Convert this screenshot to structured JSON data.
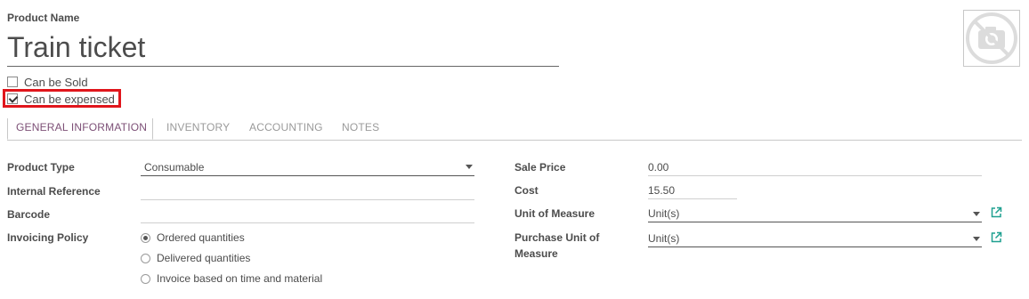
{
  "header": {
    "name_label": "Product Name",
    "name_value": "Train ticket"
  },
  "options": {
    "can_be_sold": {
      "label": "Can be Sold",
      "checked": false
    },
    "can_be_expensed": {
      "label": "Can be expensed",
      "checked": true
    }
  },
  "image": {
    "icon": "no-camera-icon"
  },
  "tabs": [
    {
      "label": "GENERAL INFORMATION",
      "active": true
    },
    {
      "label": "INVENTORY",
      "active": false
    },
    {
      "label": "ACCOUNTING",
      "active": false
    },
    {
      "label": "NOTES",
      "active": false
    }
  ],
  "left_fields": {
    "product_type": {
      "label": "Product Type",
      "value": "Consumable"
    },
    "internal_reference": {
      "label": "Internal Reference",
      "value": ""
    },
    "barcode": {
      "label": "Barcode",
      "value": ""
    },
    "invoicing_policy": {
      "label": "Invoicing Policy",
      "options": [
        {
          "label": "Ordered quantities",
          "selected": true
        },
        {
          "label": "Delivered quantities",
          "selected": false
        },
        {
          "label": "Invoice based on time and material",
          "selected": false
        }
      ]
    }
  },
  "right_fields": {
    "sale_price": {
      "label": "Sale Price",
      "value": "0.00"
    },
    "cost": {
      "label": "Cost",
      "value": "15.50"
    },
    "unit_of_measure": {
      "label": "Unit of Measure",
      "value": "Unit(s)"
    },
    "purchase_unit": {
      "label_line1": "Purchase Unit of",
      "label_line2": "Measure",
      "value": "Unit(s)"
    }
  },
  "colors": {
    "accent": "#7c4f76",
    "highlight": "#e0161c",
    "external_link": "#1fa090"
  }
}
